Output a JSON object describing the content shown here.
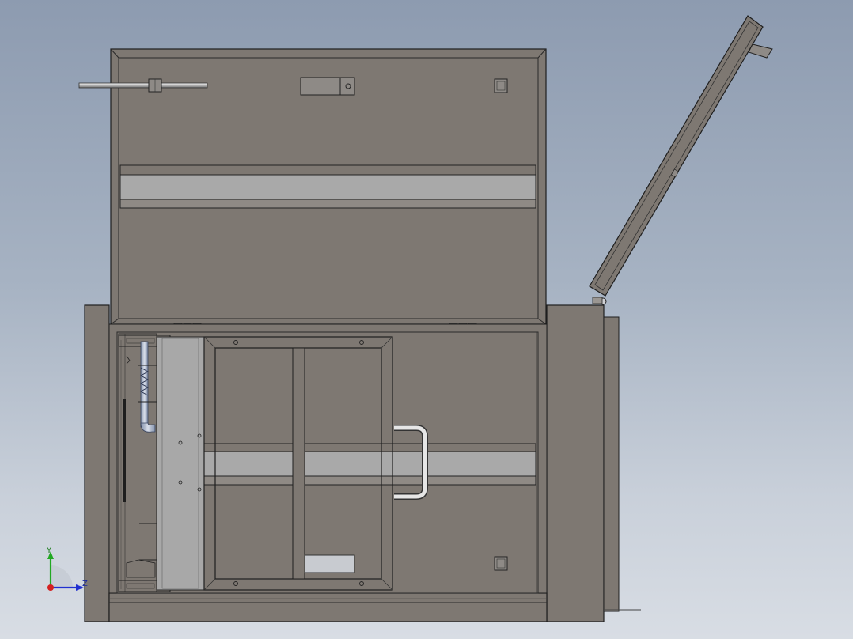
{
  "viewport": {
    "background_top": "#8d9bb0",
    "background_bottom": "#d8dde4"
  },
  "colors": {
    "panel_fill": "#7e7872",
    "panel_dark": "#6f6a65",
    "rail_fill": "#a9a9a9",
    "edge": "#1e1e1e",
    "metal_light": "#cfd0d3",
    "label_plate": "#c8cbd0",
    "axis_x": "#d42020",
    "axis_y": "#22a822",
    "axis_z": "#2030d0"
  },
  "triad": {
    "y_label": "Y",
    "z_label": "Z",
    "icon": "coordinate-triad-icon"
  }
}
